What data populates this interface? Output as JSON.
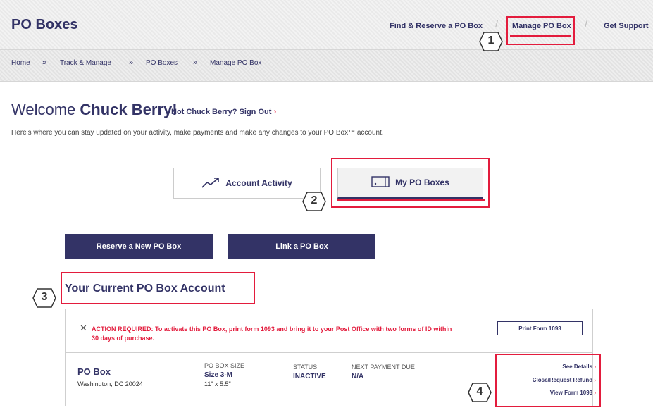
{
  "header": {
    "title": "PO Boxes",
    "nav": [
      "Find & Reserve a PO Box",
      "Manage PO Box",
      "Get Support"
    ]
  },
  "breadcrumb": [
    "Home",
    "Track & Manage",
    "PO Boxes",
    "Manage PO Box"
  ],
  "breadcrumb_separator": "»",
  "welcome": {
    "greeting": "Welcome",
    "name": "Chuck Berry!",
    "not_you": "Not Chuck Berry? Sign Out",
    "intro": "Here's where you can stay updated on your activity, make payments and make any changes to your PO Box™ account."
  },
  "tabs": [
    {
      "label": "Account Activity",
      "icon": "trend-up-icon"
    },
    {
      "label": "My PO Boxes",
      "icon": "po-box-icon"
    }
  ],
  "actions": {
    "reserve": "Reserve a New PO Box",
    "link": "Link a PO Box"
  },
  "account": {
    "title": "Your Current PO Box Account",
    "alert": "ACTION REQUIRED: To activate this PO Box, print form 1093 and bring it to your Post Office with two forms of ID within 30 days of purchase.",
    "print_button": "Print Form 1093",
    "box": {
      "name": "PO Box",
      "location": "Washington, DC 20024",
      "size_label": "PO BOX SIZE",
      "size_value": "Size 3-M",
      "size_dims": "11\" x 5.5\"",
      "status_label": "STATUS",
      "status_value": "INACTIVE",
      "payment_label": "NEXT PAYMENT DUE",
      "payment_value": "N/A"
    },
    "links": [
      "See Details",
      "Close/Request Refund",
      "View Form 1093"
    ]
  },
  "callouts": [
    "1",
    "2",
    "3",
    "4"
  ],
  "colors": {
    "navy": "#333366",
    "red": "#e31c3d"
  }
}
